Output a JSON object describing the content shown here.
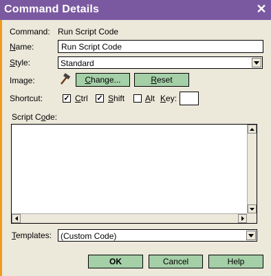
{
  "window": {
    "title": "Command Details",
    "close_symbol": "✕"
  },
  "command": {
    "label": "Command:",
    "value": "Run Script Code"
  },
  "name": {
    "label_first": "N",
    "label_rest": "ame:",
    "value": "Run Script Code"
  },
  "style": {
    "label_first": "S",
    "label_rest": "tyle:",
    "selected": "Standard"
  },
  "image": {
    "label": "Image:",
    "icon": "hammer-icon",
    "change_first": "C",
    "change_rest": "hange...",
    "reset_first": "R",
    "reset_rest": "eset"
  },
  "shortcut": {
    "label": "Shortcut:",
    "ctrl_first": "C",
    "ctrl_rest": "trl",
    "ctrl_checked": "✓",
    "shift_first": "S",
    "shift_rest": "hift",
    "shift_checked": "✓",
    "alt_first": "A",
    "alt_rest": "lt",
    "key_first": "K",
    "key_rest": "ey:",
    "key_value": ""
  },
  "script": {
    "label_a": "Script C",
    "label_u": "o",
    "label_b": "de:",
    "value": ""
  },
  "templates": {
    "label_first": "T",
    "label_rest": "emplates:",
    "selected": "(Custom Code)"
  },
  "footer": {
    "ok": "OK",
    "cancel": "Cancel",
    "help": "Help"
  },
  "colors": {
    "titlebar": "#7b59a1",
    "accent_border": "#ef9a1c",
    "button": "#a4cfa7",
    "background": "#ece8da"
  }
}
